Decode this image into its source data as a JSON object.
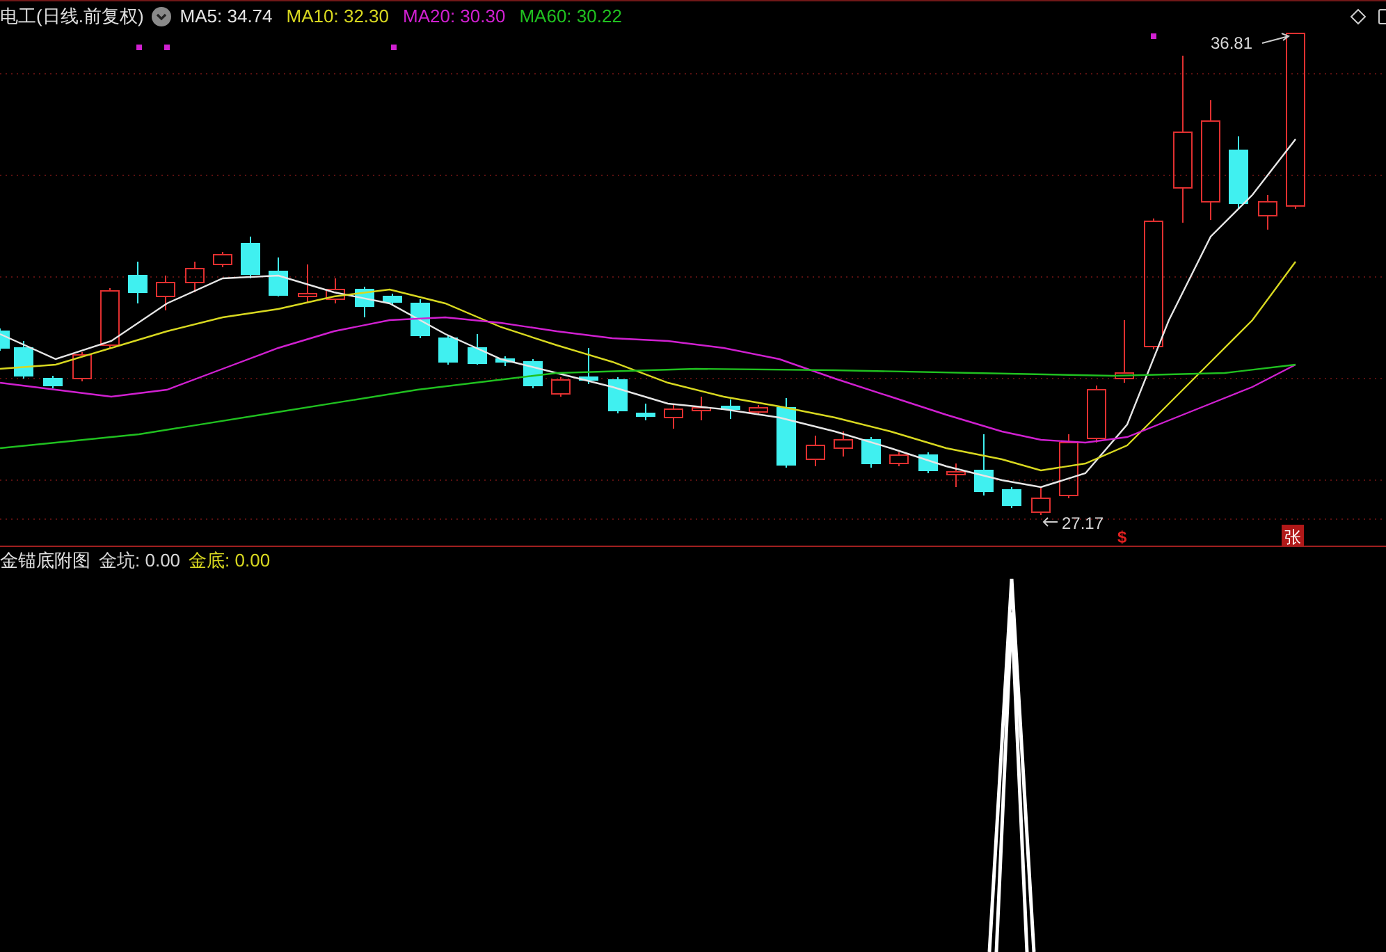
{
  "main_chart": {
    "title": "电工(日线.前复权)",
    "indicators": [
      {
        "label": "MA5: 34.74",
        "color": "#e6e6e6"
      },
      {
        "label": "MA10: 32.30",
        "color": "#d8d820"
      },
      {
        "label": "MA20: 30.30",
        "color": "#d020d0"
      },
      {
        "label": "MA60: 30.22",
        "color": "#20c020"
      }
    ],
    "high_label": "36.81",
    "low_label": "27.17",
    "signals": [
      {
        "kind": "dollar",
        "text": "$"
      },
      {
        "kind": "badge",
        "text": "张"
      }
    ]
  },
  "sub_chart": {
    "title": "金锚底附图",
    "indicators": [
      {
        "label": "金坑: 0.00",
        "color": "#d8d8d8"
      },
      {
        "label": "金底: 0.00",
        "color": "#d8d820"
      }
    ]
  }
}
